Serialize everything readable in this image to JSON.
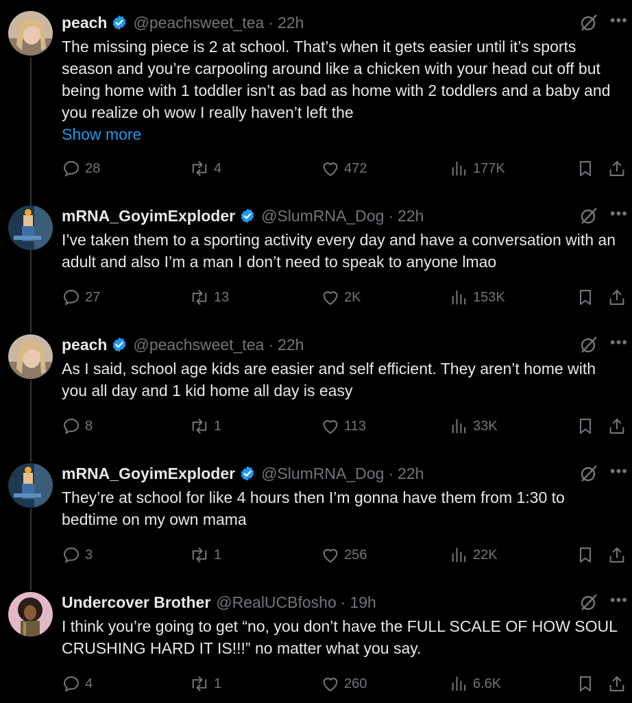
{
  "posts": [
    {
      "name": "peach",
      "handle": "@peachsweet_tea",
      "time": "22h",
      "verified": true,
      "avatar": "woman-selfie",
      "text": "The missing piece is 2 at school. That’s when it gets easier until it’s sports season and you’re carpooling around like a chicken with your head cut off but being home with 1 toddler isn’t as bad as home with 2 toddlers and a baby and you realize oh wow I really haven’t left the",
      "show_more": "Show more",
      "replies": "28",
      "reposts": "4",
      "likes": "472",
      "views": "177K"
    },
    {
      "name": "mRNA_GoyimExploder",
      "handle": "@SlumRNA_Dog",
      "time": "22h",
      "verified": true,
      "avatar": "cartoon-figure",
      "text": "I’ve taken them to a sporting activity every day and have a conversation with an adult and also I’m a man I don’t need to speak to anyone lmao",
      "replies": "27",
      "reposts": "13",
      "likes": "2K",
      "views": "153K"
    },
    {
      "name": "peach",
      "handle": "@peachsweet_tea",
      "time": "22h",
      "verified": true,
      "avatar": "woman-selfie",
      "text": "As I said, school age kids are easier and self efficient. They aren’t home with you all day and 1 kid home all day is easy",
      "replies": "8",
      "reposts": "1",
      "likes": "113",
      "views": "33K"
    },
    {
      "name": "mRNA_GoyimExploder",
      "handle": "@SlumRNA_Dog",
      "time": "22h",
      "verified": true,
      "avatar": "cartoon-figure",
      "text": "They’re at school for like 4 hours then I’m gonna have them from 1:30 to bedtime on my own mama",
      "replies": "3",
      "reposts": "1",
      "likes": "256",
      "views": "22K"
    },
    {
      "name": "Undercover Brother",
      "handle": "@RealUCBfosho",
      "time": "19h",
      "verified": false,
      "avatar": "afro-character",
      "text": "I think you’re going to get “no, you don’t have the FULL SCALE OF HOW SOUL CRUSHING HARD IT IS!!!” no matter what you say.",
      "replies": "4",
      "reposts": "1",
      "likes": "260",
      "views": "6.6K"
    }
  ],
  "icons": {
    "reply": "reply-icon",
    "repost": "repost-icon",
    "like": "like-icon",
    "views": "views-icon",
    "bookmark": "bookmark-icon",
    "share": "share-icon",
    "grok": "grok-icon",
    "more": "more-icon",
    "verified": "verified-badge-icon"
  },
  "colors": {
    "background": "#000000",
    "text": "#e7e9ea",
    "muted": "#71767b",
    "accent": "#1d9bf0"
  }
}
